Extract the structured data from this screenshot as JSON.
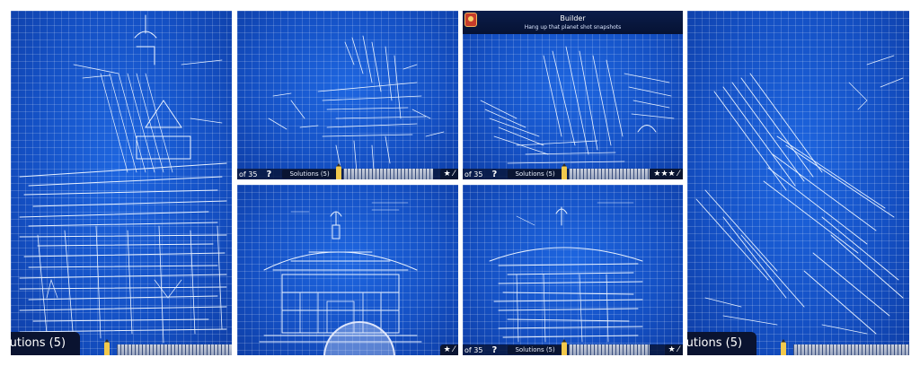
{
  "panels": {
    "p1": {
      "solutions_label": "lutions (5)"
    },
    "p2": {
      "pager": "of 35",
      "help": "?",
      "solutions_label": "Solutions (5)",
      "stars": "★ ⁄"
    },
    "p3": {
      "header_title": "Builder",
      "header_subtitle": "Hang up that planet shot snapshots",
      "pager": "of 35",
      "help": "?",
      "solutions_label": "Solutions (5)",
      "stars": "★★★ ⁄"
    },
    "p4": {
      "solutions_label": "lutions (5)"
    },
    "p5": {
      "stars": "★ ⁄"
    },
    "p6": {
      "pager": "of 35",
      "help": "?",
      "solutions_label": "Solutions (5)",
      "stars": "★ ⁄"
    }
  },
  "colors": {
    "blueprint": "#1552c9",
    "line": "#e9f2ff",
    "bar": "#0a1532"
  },
  "icons": [
    "help-icon",
    "star-icon",
    "pencil-icon",
    "ruler-icon",
    "app-badge-icon",
    "protractor-icon"
  ]
}
